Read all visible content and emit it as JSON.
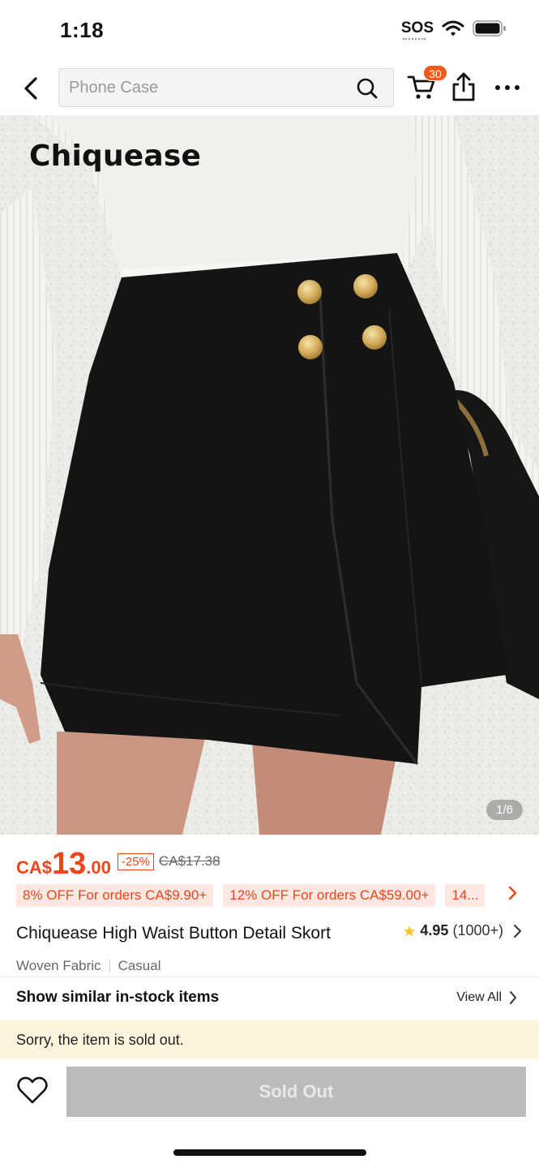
{
  "status_bar": {
    "time": "1:18",
    "sos": "SOS",
    "icons": [
      "wifi-icon",
      "battery-icon"
    ]
  },
  "nav": {
    "search_placeholder": "Phone Case",
    "cart_count": "30",
    "icons": [
      "back-icon",
      "search-icon",
      "cart-icon",
      "share-icon",
      "more-icon"
    ]
  },
  "image": {
    "brand_text": "Chiquease",
    "counter": "1/6"
  },
  "price": {
    "currency": "CA$",
    "integer": "13",
    "decimal": ".00",
    "discount": "-25%",
    "original": "CA$17.38"
  },
  "coupons": [
    "8% OFF For orders CA$9.90+",
    "12% OFF For orders CA$59.00+",
    "14..."
  ],
  "product": {
    "title": "Chiquease High Waist Button Detail Skort",
    "rating": "4.95",
    "rating_count": "(1000+)",
    "tags": [
      "Woven Fabric",
      "Casual"
    ]
  },
  "similar": {
    "title": "Show similar in-stock items",
    "view_all": "View All"
  },
  "soldout_notice": "Sorry, the item is sold out.",
  "action": {
    "button_label": "Sold Out"
  },
  "colors": {
    "accent": "#f0451b",
    "badge": "#f25a1c",
    "banner": "#fdf4dd",
    "disabled_button": "#bcbcbc"
  }
}
